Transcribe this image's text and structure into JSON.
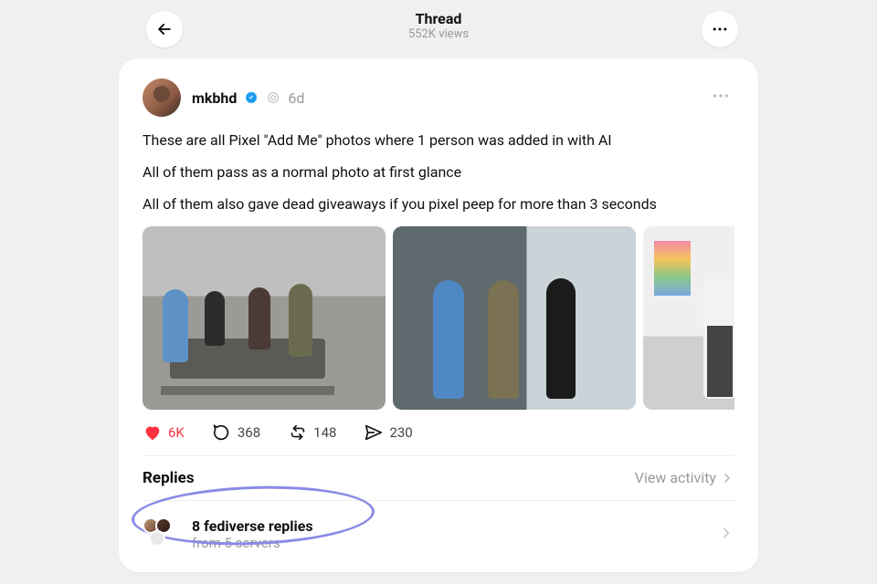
{
  "topbar": {
    "title": "Thread",
    "views": "552K views"
  },
  "post": {
    "author": "mkbhd",
    "time": "6d",
    "paragraphs": [
      "These are all Pixel \"Add Me\" photos where 1 person was added in with AI",
      "All of them pass as a normal photo at first glance",
      "All of them also gave dead giveaways if you pixel peep for more than 3 seconds"
    ],
    "image_count": 3
  },
  "actions": {
    "likes": "6K",
    "comments": "368",
    "reposts": "148",
    "shares": "230"
  },
  "replies": {
    "title": "Replies",
    "view_activity": "View activity"
  },
  "fediverse": {
    "title": "8 fediverse replies",
    "subtitle": "from 5 servers"
  }
}
